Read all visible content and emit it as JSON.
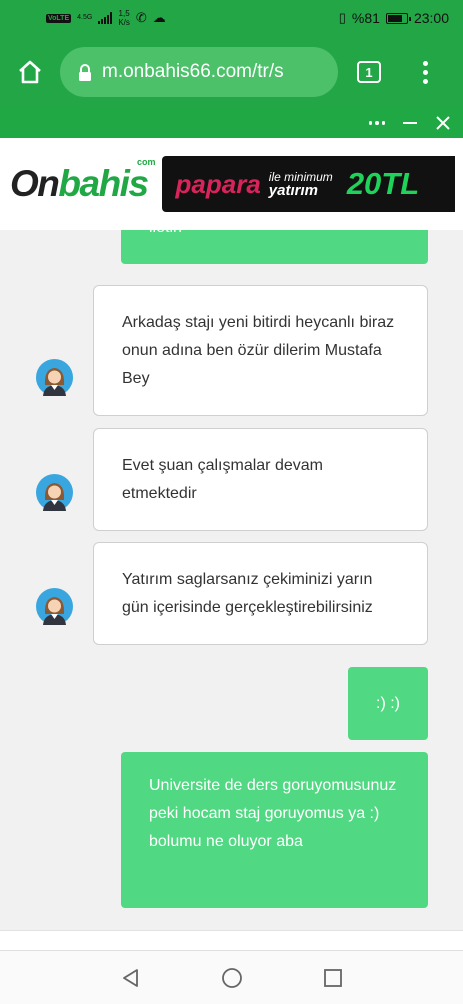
{
  "status_bar": {
    "volte": "VoLTE",
    "network": "4.5G",
    "speed_value": "1,5",
    "speed_unit": "K/s",
    "battery": "%81",
    "time": "23:00"
  },
  "browser": {
    "url": "m.onbahis66.com/tr/s",
    "tab_count": "1"
  },
  "banner": {
    "logo_dark": "On",
    "logo_green": "bahis",
    "logo_suffix": "com",
    "papara": "papara",
    "min_line1": "ile minimum",
    "min_line2": "yatırım",
    "amount": "20TL"
  },
  "chat": {
    "partial_message": "iletin",
    "messages": [
      {
        "from": "agent",
        "text": "Arkadaş stajı yeni bitirdi heycanlı biraz onun adına ben özür dilerim Mustafa Bey"
      },
      {
        "from": "agent",
        "text": "Evet şuan çalışmalar devam etmektedir"
      },
      {
        "from": "agent",
        "text": "Yatırım saglarsanız çekiminizi yarın gün içerisinde gerçekleştirebilirsiniz"
      },
      {
        "from": "user",
        "text": ":) :)"
      },
      {
        "from": "user",
        "text": "Universite de ders goruyomusunuz peki hocam staj goruyomus ya :) bolumu ne oluyor aba"
      }
    ]
  },
  "colors": {
    "chrome_green": "#22a646",
    "user_bubble": "#51d882",
    "agent_bubble": "#ffffff",
    "brand_green": "#1fa843",
    "papara_pink": "#d9245b"
  }
}
